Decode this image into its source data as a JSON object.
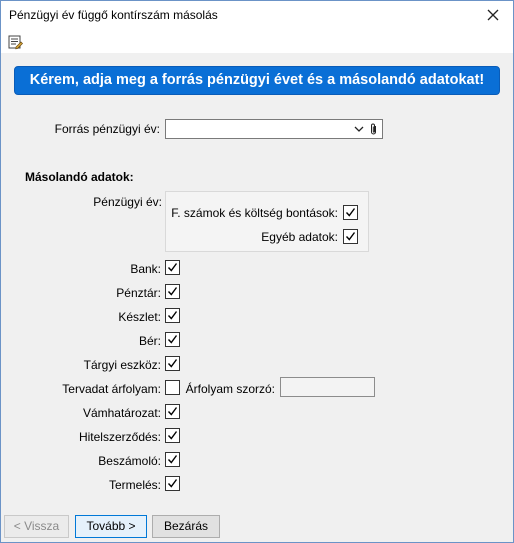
{
  "window": {
    "title": "Pénzügyi év függő kontírszám másolás"
  },
  "banner": {
    "text": "Kérem, adja meg a forrás pénzügyi évet és a másolandó adatokat!"
  },
  "source_year": {
    "label": "Forrás pénzügyi év:",
    "value": ""
  },
  "section": {
    "title": "Másolandó adatok:"
  },
  "fiscal_year": {
    "label": "Pénzügyi év:",
    "options": [
      {
        "label": "F. számok és költség bontások:",
        "checked": true
      },
      {
        "label": "Egyéb adatok:",
        "checked": true
      }
    ]
  },
  "items": [
    {
      "label": "Bank:",
      "checked": true
    },
    {
      "label": "Pénztár:",
      "checked": true
    },
    {
      "label": "Készlet:",
      "checked": true
    },
    {
      "label": "Bér:",
      "checked": true
    },
    {
      "label": "Tárgyi eszköz:",
      "checked": true
    },
    {
      "label": "Tervadat árfolyam:",
      "checked": false
    },
    {
      "label": "Vámhatározat:",
      "checked": true
    },
    {
      "label": "Hitelszerződés:",
      "checked": true
    },
    {
      "label": "Beszámoló:",
      "checked": true
    },
    {
      "label": "Termelés:",
      "checked": true
    }
  ],
  "rate_multiplier": {
    "label": "Árfolyam szorzó:",
    "value": ""
  },
  "footer": {
    "back_label": "< Vissza",
    "next_label": "Tovább >",
    "close_label": "Bezárás"
  },
  "icons": {
    "close": "close-icon",
    "toolbar": "edit-properties-icon",
    "dropdown": "chevron-down-icon",
    "attach": "paperclip-icon"
  },
  "colors": {
    "banner_bg": "#0a6fd6",
    "banner_text": "#ffffff"
  }
}
